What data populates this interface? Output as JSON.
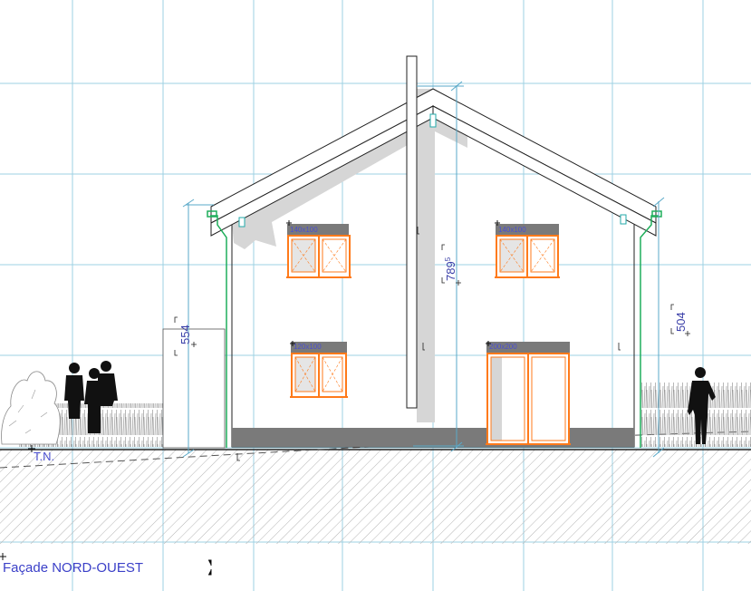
{
  "drawing": {
    "title": "Façade NORD-OUEST",
    "ground_label": "T.N.",
    "dimensions": {
      "total_height": "789",
      "total_height_sup": "5",
      "left_height": "554",
      "right_height": "504"
    },
    "windows": {
      "upper_left": "140x100",
      "upper_right": "140x100",
      "lower_left": "120x100",
      "door": "200x200"
    }
  },
  "colors": {
    "grid": "#9ed0e3",
    "frame": "#ff7a1a",
    "downpipe": "#1fae5b",
    "dimension": "#3a3fa8",
    "plinth": "#7a7a7a",
    "shadow": "#d6d6d6"
  }
}
